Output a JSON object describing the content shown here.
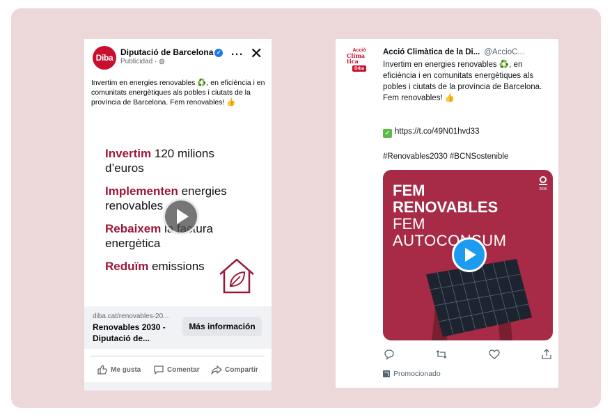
{
  "facebook_ad": {
    "page_name": "Diputació de Barcelona",
    "avatar_text": "Diba",
    "sponsored_label": "Publicidad · ",
    "post_text": "Invertim en energies renovables ♻️, en eficiència i en comunitats energètiques als pobles i ciutats de la província de Barcelona. Fem renovables! 👍",
    "creative": {
      "line1_bold": "Invertim",
      "line1_rest": " 120 milions",
      "line1b": "d’euros",
      "line2_bold": "Implementen",
      "line2_rest": " energies",
      "line2b": "renovables",
      "line3_bold": "Rebaixem",
      "line3_rest": " la factura",
      "line3b": "energètica",
      "line4_bold": "Reduïm",
      "line4_rest": " emissions"
    },
    "link": {
      "domain": "diba.cat/renovables-20...",
      "title": "Renovables 2030 - Diputació de...",
      "cta": "Más información"
    },
    "actions": {
      "like": "Me gusta",
      "comment": "Comentar",
      "share": "Compartir"
    },
    "colors": {
      "brand": "#c8102e",
      "accent": "#9c1737",
      "verified": "#1877f2"
    }
  },
  "twitter_ad": {
    "account_name": "Acció Climàtica de la Di...",
    "handle": "@AccioC...",
    "avatar_text": {
      "top": "Acció",
      "middle": "Clima tica",
      "badge": "Diba"
    },
    "tweet_text": "Invertim en energies renovables ♻️, en eficiència i en comunitats energètiques als pobles i ciutats de la província de Barcelona. Fem renovables! 👍",
    "link": "https://t.co/49N01hvd33",
    "hashtags": "#Renovables2030 #BCNSostenible",
    "media": {
      "line1": "FEM",
      "line2": "RENOVABLES",
      "line3": "FEM",
      "line4": "AUTOCONSUM",
      "logo_label": "2030"
    },
    "actions": [
      "reply-icon",
      "retweet-icon",
      "like-icon",
      "share-icon"
    ],
    "promoted_label": "Promocionado",
    "colors": {
      "media_bg": "#a72b46",
      "play": "#1d9bf0",
      "check": "#5dbb46"
    }
  },
  "background": {
    "panel_color": "#ecd7d9"
  }
}
